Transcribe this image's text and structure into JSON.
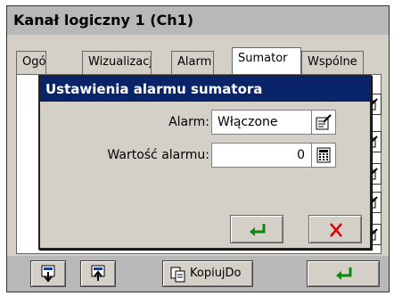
{
  "window": {
    "title": "Kanał logiczny 1 (Ch1)"
  },
  "tabs": [
    {
      "label": "Ogólne"
    },
    {
      "label": "Wizualizacja"
    },
    {
      "label": "Alarm"
    },
    {
      "label": "Sumator"
    },
    {
      "label": "Wspólne"
    }
  ],
  "dialog": {
    "title": "Ustawienia alarmu sumatora",
    "alarm_label": "Alarm:",
    "alarm_value": "Włączone",
    "value_label": "Wartość alarmu:",
    "value_value": "0"
  },
  "bottom": {
    "copy_label": "KopiujDo"
  },
  "colors": {
    "dialog_title_bg": "#0a246a",
    "ok_green": "#0a8a0a",
    "cancel_red": "#e00000"
  }
}
